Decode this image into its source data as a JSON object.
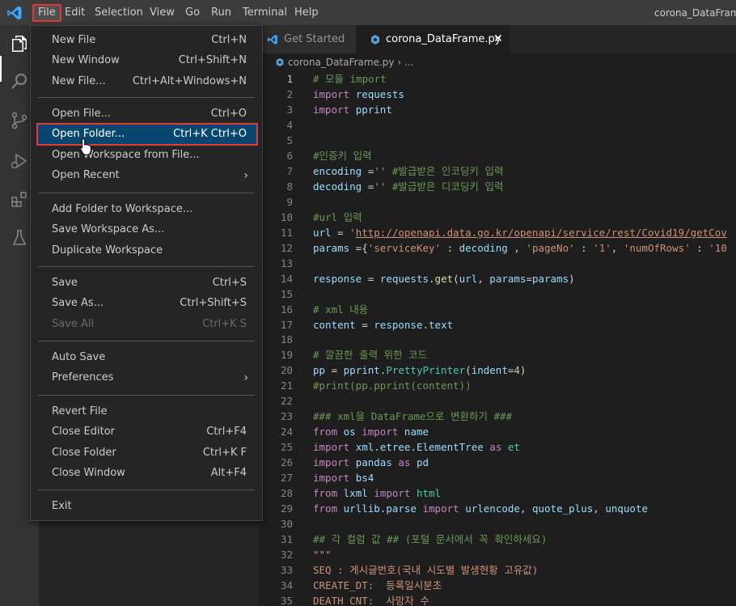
{
  "menubar": {
    "items": [
      "File",
      "Edit",
      "Selection",
      "View",
      "Go",
      "Run",
      "Terminal",
      "Help"
    ],
    "window_title": "corona_DataFrame."
  },
  "tabs": [
    {
      "label": "Get Started",
      "active": false
    },
    {
      "label": "corona_DataFrame.py",
      "active": true
    }
  ],
  "breadcrumb": {
    "file": "corona_DataFrame.py",
    "sep": " › ..."
  },
  "file_menu": {
    "groups": [
      [
        {
          "label": "New File",
          "shortcut": "Ctrl+N"
        },
        {
          "label": "New Window",
          "shortcut": "Ctrl+Shift+N"
        },
        {
          "label": "New File...",
          "shortcut": "Ctrl+Alt+Windows+N"
        }
      ],
      [
        {
          "label": "Open File...",
          "shortcut": "Ctrl+O"
        },
        {
          "label": "Open Folder...",
          "shortcut": "Ctrl+K Ctrl+O",
          "highlighted": true
        },
        {
          "label": "Open Workspace from File...",
          "shortcut": ""
        },
        {
          "label": "Open Recent",
          "shortcut": "",
          "submenu": true
        }
      ],
      [
        {
          "label": "Add Folder to Workspace...",
          "shortcut": ""
        },
        {
          "label": "Save Workspace As...",
          "shortcut": ""
        },
        {
          "label": "Duplicate Workspace",
          "shortcut": ""
        }
      ],
      [
        {
          "label": "Save",
          "shortcut": "Ctrl+S"
        },
        {
          "label": "Save As...",
          "shortcut": "Ctrl+Shift+S"
        },
        {
          "label": "Save All",
          "shortcut": "Ctrl+K S",
          "disabled": true
        }
      ],
      [
        {
          "label": "Auto Save",
          "shortcut": ""
        },
        {
          "label": "Preferences",
          "shortcut": "",
          "submenu": true
        }
      ],
      [
        {
          "label": "Revert File",
          "shortcut": ""
        },
        {
          "label": "Close Editor",
          "shortcut": "Ctrl+F4"
        },
        {
          "label": "Close Folder",
          "shortcut": "Ctrl+K F"
        },
        {
          "label": "Close Window",
          "shortcut": "Alt+F4"
        }
      ],
      [
        {
          "label": "Exit",
          "shortcut": ""
        }
      ]
    ]
  },
  "editor": {
    "lines": [
      {
        "n": "1",
        "tokens": [
          [
            "cm",
            "# 모듈 import"
          ]
        ]
      },
      {
        "n": "2",
        "tokens": [
          [
            "kw",
            "import"
          ],
          [
            "op",
            " "
          ],
          [
            "id",
            "requests"
          ]
        ]
      },
      {
        "n": "3",
        "tokens": [
          [
            "kw",
            "import"
          ],
          [
            "op",
            " "
          ],
          [
            "id",
            "pprint"
          ]
        ]
      },
      {
        "n": "4",
        "tokens": []
      },
      {
        "n": "5",
        "tokens": []
      },
      {
        "n": "6",
        "tokens": [
          [
            "cm",
            "#인증키 입력"
          ]
        ]
      },
      {
        "n": "7",
        "tokens": [
          [
            "id",
            "encoding"
          ],
          [
            "op",
            " ="
          ],
          [
            "st",
            "''"
          ],
          [
            "op",
            " "
          ],
          [
            "cm",
            "#발급받은 인코딩키 입력"
          ]
        ]
      },
      {
        "n": "8",
        "tokens": [
          [
            "id",
            "decoding"
          ],
          [
            "op",
            " ="
          ],
          [
            "st",
            "''"
          ],
          [
            "op",
            " "
          ],
          [
            "cm",
            "#발급받은 디코딩키 입력"
          ]
        ]
      },
      {
        "n": "9",
        "tokens": []
      },
      {
        "n": "10",
        "tokens": [
          [
            "cm",
            "#url 입력"
          ]
        ]
      },
      {
        "n": "11",
        "tokens": [
          [
            "id",
            "url"
          ],
          [
            "op",
            " = "
          ],
          [
            "st",
            "'"
          ],
          [
            "stu",
            "http://openapi.data.go.kr/openapi/service/rest/Covid19/getCov"
          ]
        ]
      },
      {
        "n": "12",
        "tokens": [
          [
            "id",
            "params"
          ],
          [
            "op",
            " ={"
          ],
          [
            "st",
            "'serviceKey'"
          ],
          [
            "op",
            " : "
          ],
          [
            "id",
            "decoding"
          ],
          [
            "op",
            " , "
          ],
          [
            "st",
            "'pageNo'"
          ],
          [
            "op",
            " : "
          ],
          [
            "st",
            "'1'"
          ],
          [
            "op",
            ", "
          ],
          [
            "st",
            "'numOfRows'"
          ],
          [
            "op",
            " : "
          ],
          [
            "st",
            "'10"
          ]
        ]
      },
      {
        "n": "13",
        "tokens": []
      },
      {
        "n": "14",
        "tokens": [
          [
            "id",
            "response"
          ],
          [
            "op",
            " = "
          ],
          [
            "id",
            "requests"
          ],
          [
            "op",
            "."
          ],
          [
            "fn",
            "get"
          ],
          [
            "op",
            "("
          ],
          [
            "id",
            "url"
          ],
          [
            "op",
            ", "
          ],
          [
            "id",
            "params"
          ],
          [
            "op",
            "="
          ],
          [
            "id",
            "params"
          ],
          [
            "op",
            ")"
          ]
        ]
      },
      {
        "n": "15",
        "tokens": []
      },
      {
        "n": "16",
        "tokens": [
          [
            "cm",
            "# xml 내용"
          ]
        ]
      },
      {
        "n": "17",
        "tokens": [
          [
            "id",
            "content"
          ],
          [
            "op",
            " = "
          ],
          [
            "id",
            "response"
          ],
          [
            "op",
            "."
          ],
          [
            "id",
            "text"
          ]
        ]
      },
      {
        "n": "18",
        "tokens": []
      },
      {
        "n": "19",
        "tokens": [
          [
            "cm",
            "# 깔끔한 출력 위한 코드"
          ]
        ]
      },
      {
        "n": "20",
        "tokens": [
          [
            "id",
            "pp"
          ],
          [
            "op",
            " = "
          ],
          [
            "id",
            "pprint"
          ],
          [
            "op",
            "."
          ],
          [
            "cl",
            "PrettyPrinter"
          ],
          [
            "op",
            "("
          ],
          [
            "id",
            "indent"
          ],
          [
            "op",
            "="
          ],
          [
            "nm",
            "4"
          ],
          [
            "op",
            ")"
          ]
        ]
      },
      {
        "n": "21",
        "tokens": [
          [
            "cm",
            "#print(pp.pprint(content))"
          ]
        ]
      },
      {
        "n": "22",
        "tokens": []
      },
      {
        "n": "23",
        "tokens": [
          [
            "cm",
            "### xml을 DataFrame으로 변환하기 ###"
          ]
        ]
      },
      {
        "n": "24",
        "tokens": [
          [
            "kw",
            "from"
          ],
          [
            "op",
            " "
          ],
          [
            "id",
            "os"
          ],
          [
            "op",
            " "
          ],
          [
            "kw",
            "import"
          ],
          [
            "op",
            " "
          ],
          [
            "id",
            "name"
          ]
        ]
      },
      {
        "n": "25",
        "tokens": [
          [
            "kw",
            "import"
          ],
          [
            "op",
            " "
          ],
          [
            "id",
            "xml"
          ],
          [
            "op",
            "."
          ],
          [
            "id",
            "etree"
          ],
          [
            "op",
            "."
          ],
          [
            "id",
            "ElementTree"
          ],
          [
            "op",
            " "
          ],
          [
            "kw",
            "as"
          ],
          [
            "op",
            " "
          ],
          [
            "cl",
            "et"
          ]
        ]
      },
      {
        "n": "26",
        "tokens": [
          [
            "kw",
            "import"
          ],
          [
            "op",
            " "
          ],
          [
            "id",
            "pandas"
          ],
          [
            "op",
            " "
          ],
          [
            "kw",
            "as"
          ],
          [
            "op",
            " "
          ],
          [
            "id",
            "pd"
          ]
        ]
      },
      {
        "n": "27",
        "tokens": [
          [
            "kw",
            "import"
          ],
          [
            "op",
            " "
          ],
          [
            "id",
            "bs4"
          ]
        ]
      },
      {
        "n": "28",
        "tokens": [
          [
            "kw",
            "from"
          ],
          [
            "op",
            " "
          ],
          [
            "id",
            "lxml"
          ],
          [
            "op",
            " "
          ],
          [
            "kw",
            "import"
          ],
          [
            "op",
            " "
          ],
          [
            "cl",
            "html"
          ]
        ]
      },
      {
        "n": "29",
        "tokens": [
          [
            "kw",
            "from"
          ],
          [
            "op",
            " "
          ],
          [
            "id",
            "urllib"
          ],
          [
            "op",
            "."
          ],
          [
            "id",
            "parse"
          ],
          [
            "op",
            " "
          ],
          [
            "kw",
            "import"
          ],
          [
            "op",
            " "
          ],
          [
            "id",
            "urlencode"
          ],
          [
            "op",
            ", "
          ],
          [
            "id",
            "quote_plus"
          ],
          [
            "op",
            ", "
          ],
          [
            "id",
            "unquote"
          ]
        ]
      },
      {
        "n": "30",
        "tokens": []
      },
      {
        "n": "31",
        "tokens": [
          [
            "cm",
            "## 각 컬럼 값 ## (포털 문서에서 꼭 확인하세요)"
          ]
        ]
      },
      {
        "n": "32",
        "tokens": [
          [
            "st",
            "\"\"\""
          ]
        ]
      },
      {
        "n": "33",
        "tokens": [
          [
            "st",
            "SEQ : 게시글번호(국내 시도별 발생현황 고유값)"
          ]
        ]
      },
      {
        "n": "34",
        "tokens": [
          [
            "st",
            "CREATE_DT:  등록일시분초"
          ]
        ]
      },
      {
        "n": "35",
        "tokens": [
          [
            "st",
            "DEATH_CNT:  사망자 수"
          ]
        ]
      }
    ]
  }
}
